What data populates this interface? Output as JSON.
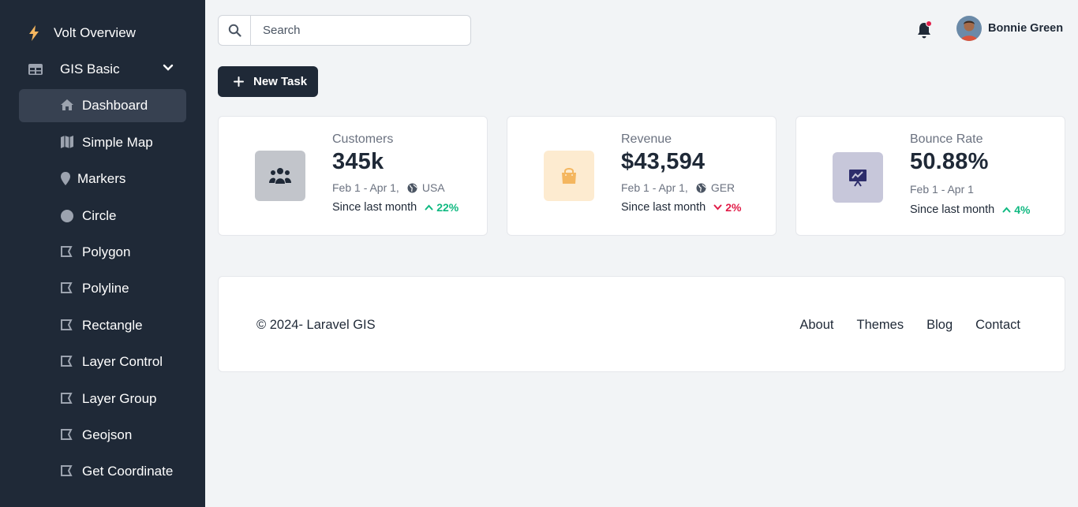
{
  "sidebar": {
    "brand": "Volt Overview",
    "group": "GIS Basic",
    "items": [
      {
        "label": "Dashboard",
        "icon": "home-icon",
        "active": true
      },
      {
        "label": "Simple Map",
        "icon": "map-icon"
      },
      {
        "label": "Markers",
        "icon": "marker-icon"
      },
      {
        "label": "Circle",
        "icon": "circle-icon"
      },
      {
        "label": "Polygon",
        "icon": "shape-icon"
      },
      {
        "label": "Polyline",
        "icon": "shape-icon"
      },
      {
        "label": "Rectangle",
        "icon": "shape-icon"
      },
      {
        "label": "Layer Control",
        "icon": "shape-icon"
      },
      {
        "label": "Layer Group",
        "icon": "shape-icon"
      },
      {
        "label": "Geojson",
        "icon": "shape-icon"
      },
      {
        "label": "Get Coordinate",
        "icon": "shape-icon"
      }
    ]
  },
  "header": {
    "search_placeholder": "Search",
    "user_name": "Bonnie Green"
  },
  "actions": {
    "new_task": "New Task"
  },
  "cards": [
    {
      "title": "Customers",
      "value": "345k",
      "period": "Feb 1 - Apr 1,",
      "region": "USA",
      "since": "Since last month",
      "delta": "22%",
      "trend": "up",
      "tile_color": "#c2c5cb"
    },
    {
      "title": "Revenue",
      "value": "$43,594",
      "period": "Feb 1 - Apr 1,",
      "region": "GER",
      "since": "Since last month",
      "delta": "2%",
      "trend": "down",
      "tile_color": "#fdebd0"
    },
    {
      "title": "Bounce Rate",
      "value": "50.88%",
      "period": "Feb 1 - Apr 1",
      "region": "",
      "since": "Since last month",
      "delta": "4%",
      "trend": "up",
      "tile_color": "#c7c7da"
    }
  ],
  "footer": {
    "copyright": "© 2024- Laravel GIS",
    "links": [
      "About",
      "Themes",
      "Blog",
      "Contact"
    ]
  },
  "colors": {
    "sidebar_bg": "#1f2937",
    "active_item_bg": "#374151",
    "positive": "#10b981",
    "negative": "#e11d48"
  }
}
